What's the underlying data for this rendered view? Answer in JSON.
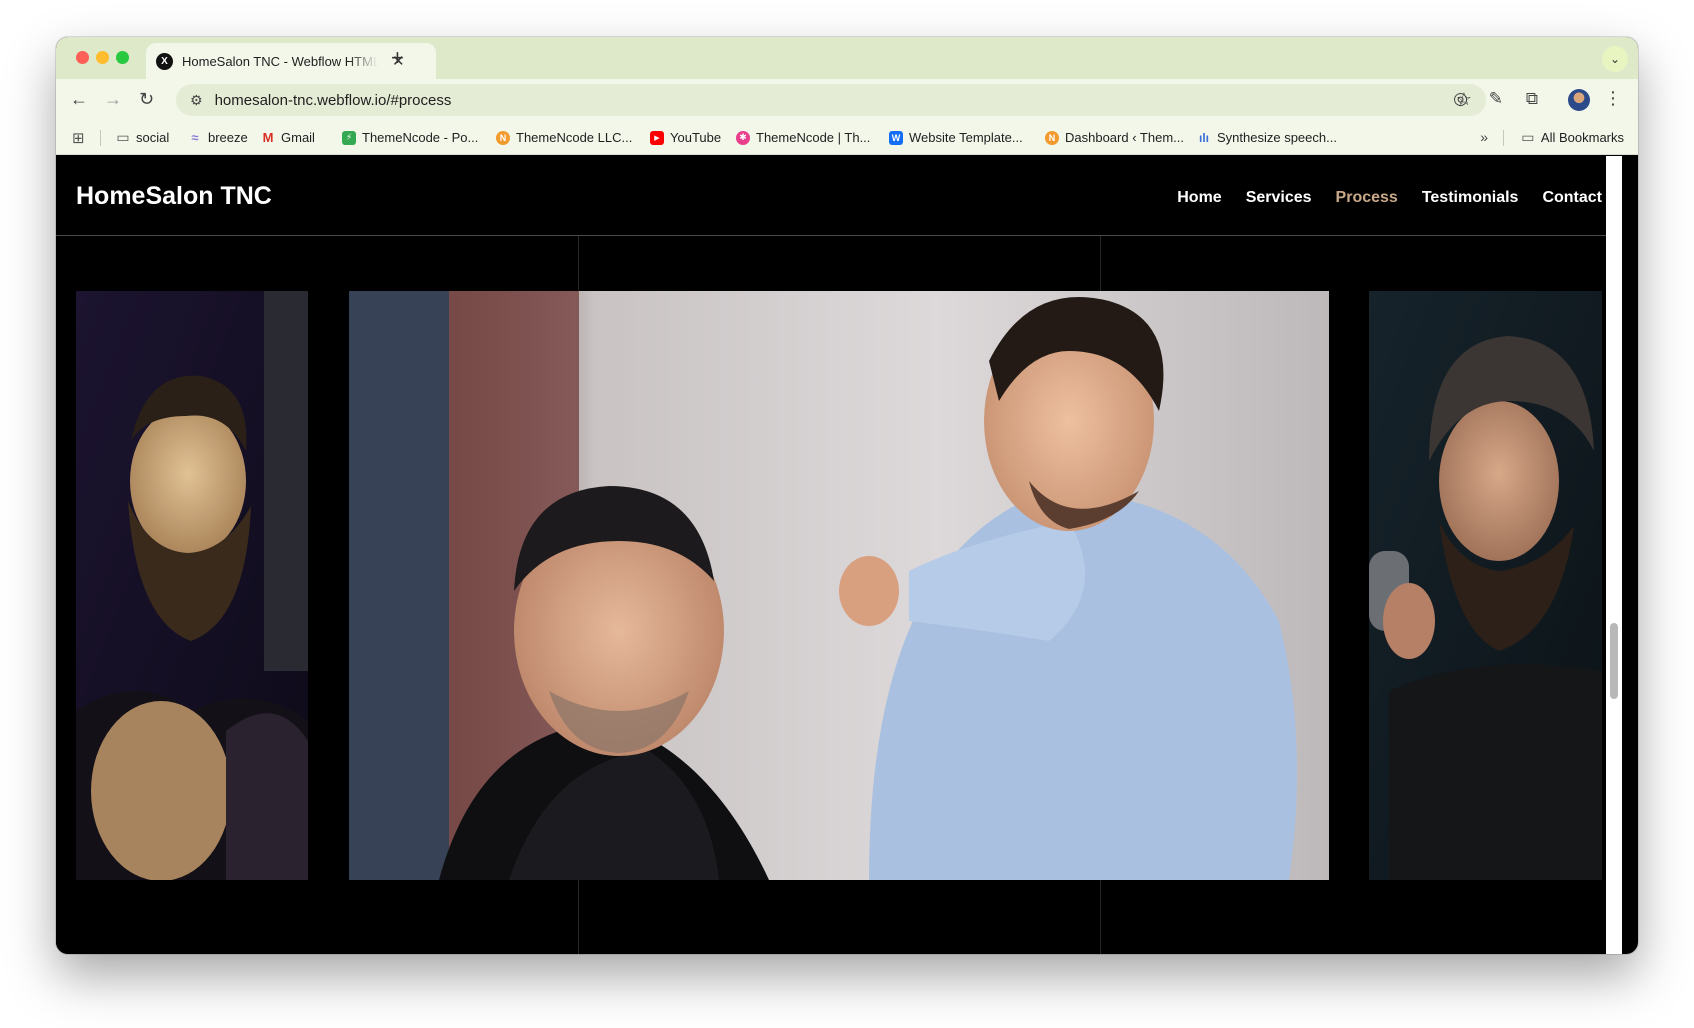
{
  "browser": {
    "tab_title": "HomeSalon TNC - Webflow HTML website template",
    "favicon_letter": "X",
    "url": "homesalon-tnc.webflow.io/#process",
    "bookmarks": [
      {
        "label": "social",
        "icon": "folder-icon"
      },
      {
        "label": "breeze",
        "icon": "breeze-icon"
      },
      {
        "label": "Gmail",
        "icon": "gmail-icon"
      },
      {
        "label": "ThemeNcode - Po...",
        "icon": "themencode-icon"
      },
      {
        "label": "ThemeNcode LLC...",
        "icon": "themencode-llc-icon"
      },
      {
        "label": "YouTube",
        "icon": "youtube-icon"
      },
      {
        "label": "ThemeNcode | Th...",
        "icon": "themencode-pink-icon"
      },
      {
        "label": "Website Template...",
        "icon": "webflow-icon"
      },
      {
        "label": "Dashboard ‹ Them...",
        "icon": "dashboard-icon"
      },
      {
        "label": "Synthesize speech...",
        "icon": "speech-icon"
      }
    ],
    "all_bookmarks_label": "All Bookmarks"
  },
  "site": {
    "brand": "HomeSalon TNC",
    "nav": [
      {
        "label": "Home",
        "active": false
      },
      {
        "label": "Services",
        "active": false
      },
      {
        "label": "Process",
        "active": true
      },
      {
        "label": "Testimonials",
        "active": false
      },
      {
        "label": "Contact",
        "active": false
      }
    ],
    "active_color": "#c9a98a"
  }
}
